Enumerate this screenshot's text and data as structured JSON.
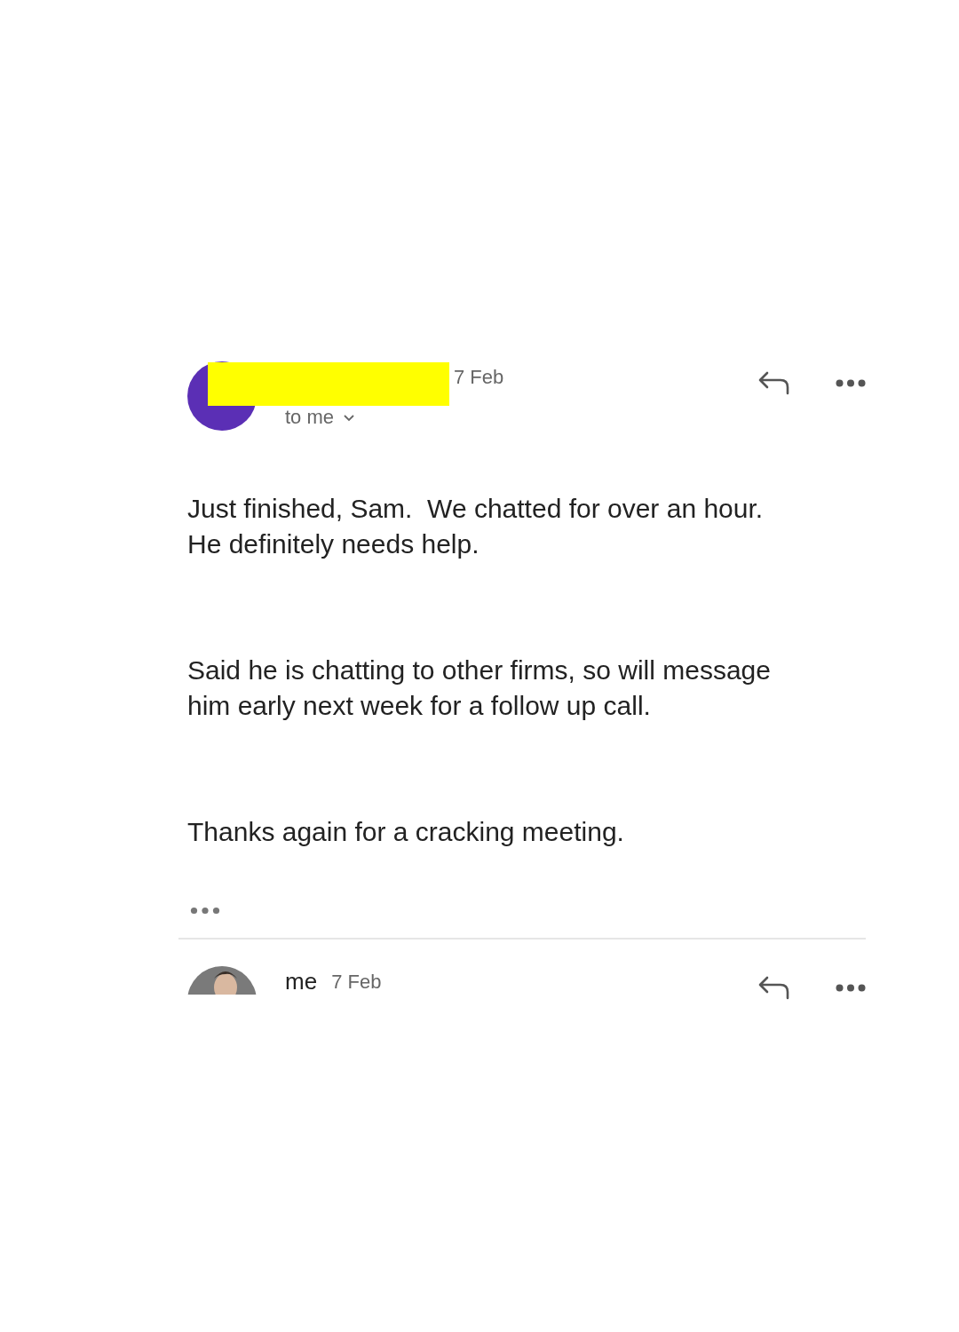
{
  "message": {
    "date": "7 Feb",
    "recipient": "to me",
    "redacted": true,
    "paragraphs": [
      {
        "lines": [
          "Just finished, Sam.  We chatted for over an hour.",
          "He definitely needs help."
        ]
      },
      {
        "lines": [
          "Said he is chatting to other firms, so will message",
          "him early next week for a follow up call."
        ]
      },
      {
        "lines": [
          "Thanks again for a cracking meeting."
        ]
      }
    ]
  },
  "reply": {
    "sender": "me",
    "date": "7 Feb"
  }
}
